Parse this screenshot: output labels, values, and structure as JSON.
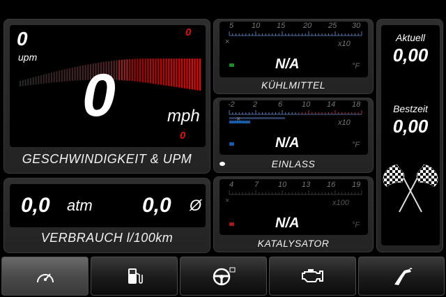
{
  "speed_panel": {
    "rpm_value": "0",
    "rpm_unit": "upm",
    "rpm_red_value": "0",
    "speed_value": "0",
    "speed_unit": "mph",
    "speed_red_value": "0",
    "caption": "GESCHWINDIGKEIT & UPM"
  },
  "consumption_panel": {
    "pressure_value": "0,0",
    "pressure_unit": "atm",
    "avg_value": "0,0",
    "avg_unit": "Ø",
    "caption": "VERBRAUCH l/100km"
  },
  "coolant_gauge": {
    "ticks": [
      "5",
      "10",
      "15",
      "20",
      "25",
      "30"
    ],
    "multiplier": "x10",
    "value": "N/A",
    "unit": "°F",
    "caption": "KÜHLMITTEL",
    "indicator_color": "#1a8a2a"
  },
  "intake_gauge": {
    "ticks": [
      "-2",
      "2",
      "6",
      "10",
      "14",
      "18"
    ],
    "multiplier": "x10",
    "value": "N/A",
    "unit": "°F",
    "caption": "EINLASS",
    "indicator_color": "#1a5aa8"
  },
  "catalyst_gauge": {
    "ticks": [
      "4",
      "7",
      "10",
      "13",
      "16",
      "19"
    ],
    "multiplier": "x100",
    "value": "N/A",
    "unit": "°F",
    "caption": "KATALYSATOR",
    "indicator_color": "#a81a1a"
  },
  "lap_panel": {
    "current_label": "Aktuell",
    "current_value": "0,00",
    "best_label": "Bestzeit",
    "best_value": "0,00"
  },
  "tabs": [
    {
      "icon": "speedometer-icon",
      "active": true
    },
    {
      "icon": "fuel-pump-icon",
      "active": false
    },
    {
      "icon": "steering-wheel-icon",
      "active": false
    },
    {
      "icon": "engine-icon",
      "active": false
    },
    {
      "icon": "fuel-nozzle-icon",
      "active": false
    }
  ]
}
